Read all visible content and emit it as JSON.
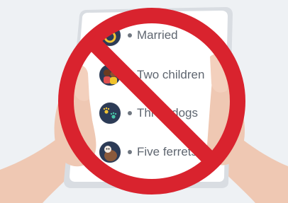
{
  "list": {
    "items": [
      {
        "label": "Married",
        "icon": "ring-icon"
      },
      {
        "label": "Two children",
        "icon": "children-icon"
      },
      {
        "label": "Three dogs",
        "icon": "paw-prints-icon"
      },
      {
        "label": "Five ferrets",
        "icon": "ferret-icon"
      }
    ]
  },
  "colors": {
    "background": "#eef1f4",
    "skin": "#efc8b3",
    "phone_screen": "#ffffff",
    "prohibition_red": "#d9232e",
    "badge": "#2c3b56",
    "text": "#5f6670"
  }
}
